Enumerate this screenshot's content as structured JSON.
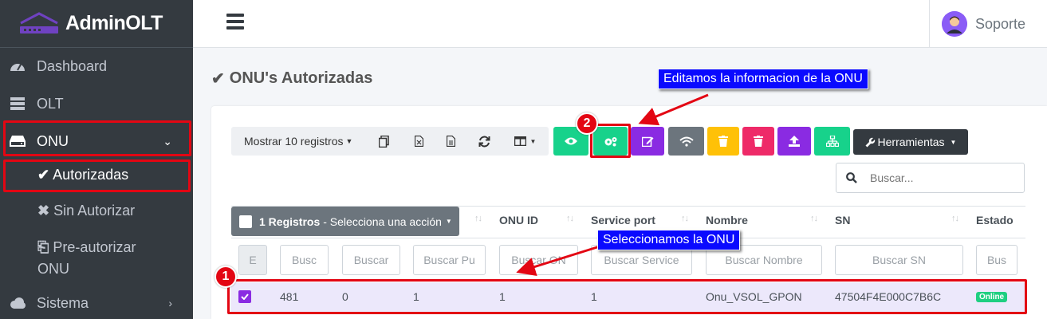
{
  "brand": {
    "name": "AdminOLT"
  },
  "sidebar": {
    "items": [
      {
        "label": "Dashboard",
        "icon": "tachometer-icon"
      },
      {
        "label": "OLT",
        "icon": "server-icon"
      },
      {
        "label": "ONU",
        "icon": "hdd-icon"
      },
      {
        "label": "Sistema",
        "icon": "cloud-icon"
      }
    ],
    "subitems": [
      {
        "label": "Autorizadas",
        "icon": "check-icon"
      },
      {
        "label": "Sin Autorizar",
        "icon": "times-icon"
      },
      {
        "label": "Pre-autorizar ONU",
        "line1": "Pre-autorizar",
        "line2": "ONU",
        "icon": "plug-icon"
      }
    ]
  },
  "header": {
    "user": "Soporte"
  },
  "page": {
    "title": "ONU's Autorizadas"
  },
  "toolbar": {
    "show_records": "Mostrar 10 registros",
    "tools": "Herramientas"
  },
  "search": {
    "placeholder": "Buscar..."
  },
  "table": {
    "select_count": "1 Registros",
    "select_action": "- Selecciona una acción",
    "columns": [
      "ONU ID",
      "Service port",
      "Nombre",
      "SN",
      "Estado"
    ],
    "filters": [
      "E",
      "Busc",
      "Buscar",
      "Buscar Pu",
      "Buscar ON",
      "Buscar Service",
      "Buscar Nombre",
      "Buscar SN",
      "Bus"
    ],
    "row": {
      "id": "481",
      "c2": "0",
      "c3": "1",
      "onu_id": "1",
      "service_port": "1",
      "nombre": "Onu_VSOL_GPON",
      "sn": "47504F4E000C7B6C",
      "estado": "Online"
    }
  },
  "annotations": {
    "callout_edit": "Editamos la informacion de la ONU",
    "callout_select": "Seleccionamos la ONU",
    "step1": "1",
    "step2": "2"
  },
  "colors": {
    "sidebar_bg": "#343a40",
    "highlight_red": "#e30613",
    "callout_blue": "#0a0aff",
    "btn_green": "#17d28b",
    "btn_purple": "#8a2be2",
    "btn_gray": "#6c757d",
    "btn_yellow": "#ffc107",
    "btn_pink": "#ee2a68",
    "btn_dark": "#343a40",
    "online_green": "#1fcf81"
  }
}
